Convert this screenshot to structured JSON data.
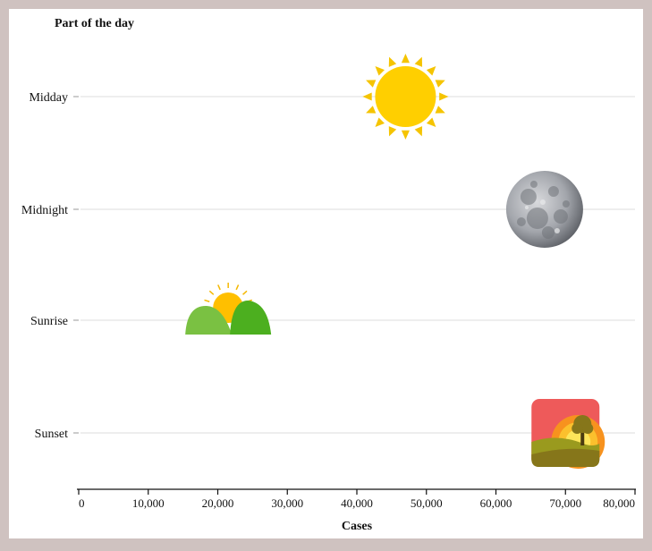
{
  "chart_data": {
    "type": "scatter",
    "title": "",
    "ylabel": "Part of the day",
    "xlabel": "Cases",
    "xlim": [
      0,
      80000
    ],
    "x_ticks": [
      0,
      10000,
      20000,
      30000,
      40000,
      50000,
      60000,
      70000,
      80000
    ],
    "x_tick_labels": [
      "0",
      "10,000",
      "20,000",
      "30,000",
      "40,000",
      "50,000",
      "60,000",
      "70,000",
      "80,000"
    ],
    "categories": [
      "Midday",
      "Midnight",
      "Sunrise",
      "Sunset"
    ],
    "points": [
      {
        "category": "Midday",
        "x": 47000,
        "icon": "sun-icon"
      },
      {
        "category": "Midnight",
        "x": 67000,
        "icon": "moon-icon"
      },
      {
        "category": "Sunrise",
        "x": 21500,
        "icon": "sunrise-icon"
      },
      {
        "category": "Sunset",
        "x": 70000,
        "icon": "sunset-icon"
      }
    ],
    "grid": true
  }
}
